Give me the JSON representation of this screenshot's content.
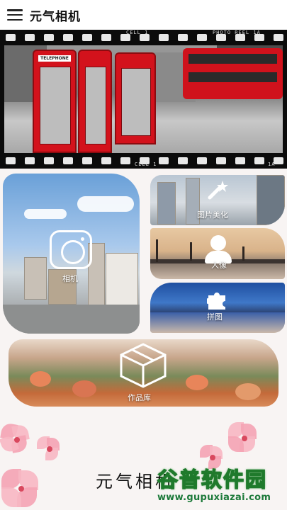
{
  "app": {
    "title": "元气相机"
  },
  "banner": {
    "film_top_left": "CELL 1",
    "film_top_right": "PHOTO REEL 1A",
    "film_bottom_left": "CELL 1",
    "film_bottom_right": "1A",
    "booth_sign": "TELEPHONE"
  },
  "cards": {
    "camera": {
      "label": "相机",
      "icon": "camera-icon"
    },
    "beautify": {
      "label": "图片美化",
      "icon": "magic-wand-icon"
    },
    "portrait": {
      "label": "人像",
      "icon": "person-icon"
    },
    "collage": {
      "label": "拼图",
      "icon": "puzzle-icon"
    },
    "gallery": {
      "label": "作品库",
      "icon": "box-icon"
    }
  },
  "footer": {
    "title": "元气相机"
  },
  "watermark": {
    "main": "谷普软件园",
    "sub": "www.gupuxiazai.com"
  }
}
